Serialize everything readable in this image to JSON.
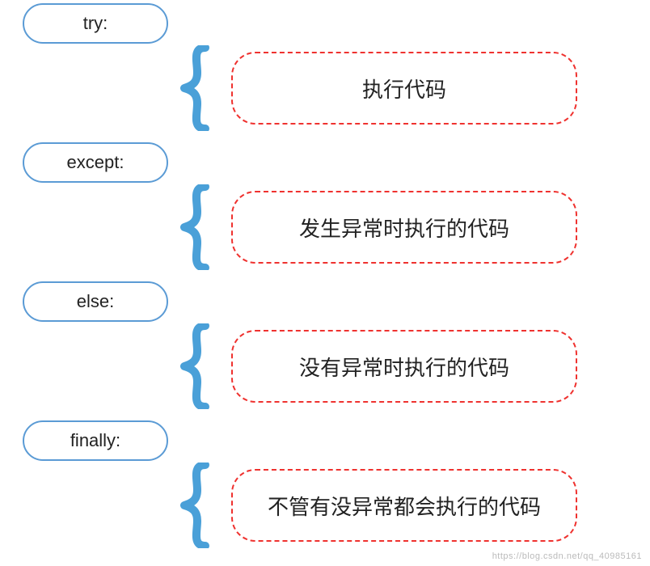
{
  "blocks": [
    {
      "keyword": "try:",
      "desc": "执行代码"
    },
    {
      "keyword": "except:",
      "desc": "发生异常时执行的代码"
    },
    {
      "keyword": "else:",
      "desc": "没有异常时执行的代码"
    },
    {
      "keyword": "finally:",
      "desc": "不管有没异常都会执行的代码"
    }
  ],
  "watermark": "https://blog.csdn.net/qq_40985161"
}
